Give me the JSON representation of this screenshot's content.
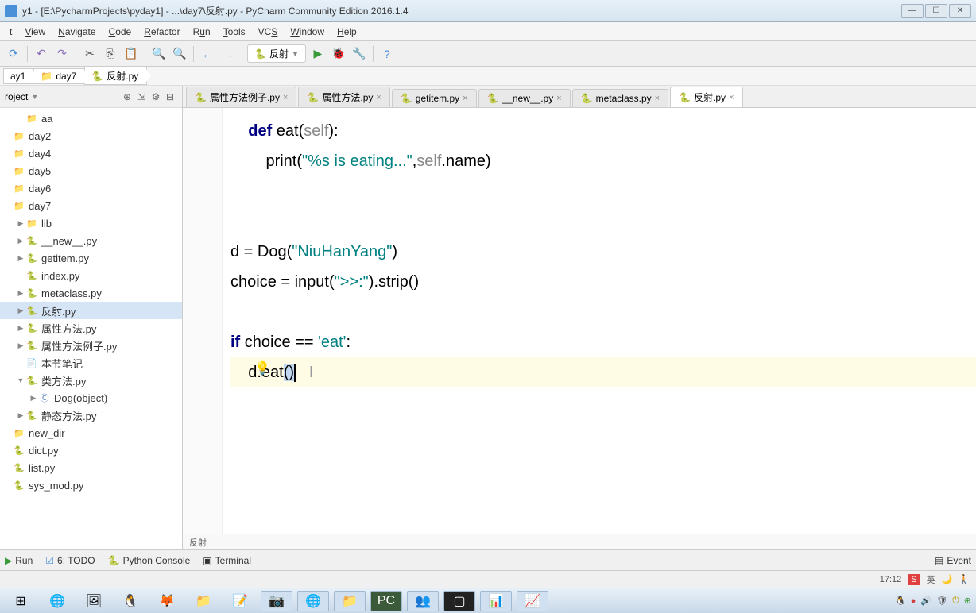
{
  "window": {
    "title": "y1 - [E:\\PycharmProjects\\pyday1] - ...\\day7\\反射.py - PyCharm Community Edition 2016.1.4"
  },
  "menu": {
    "items": [
      "t",
      "View",
      "Navigate",
      "Code",
      "Refactor",
      "Run",
      "Tools",
      "VCS",
      "Window",
      "Help"
    ]
  },
  "toolbar": {
    "run_config": "反射"
  },
  "breadcrumb": {
    "items": [
      "ay1",
      "day7",
      "反射.py"
    ]
  },
  "project": {
    "header": "roject",
    "tree": [
      {
        "label": "aa",
        "indent": 1,
        "icon": "folder",
        "arrow": ""
      },
      {
        "label": "day2",
        "indent": 0,
        "icon": "folder",
        "arrow": ""
      },
      {
        "label": "day4",
        "indent": 0,
        "icon": "folder",
        "arrow": ""
      },
      {
        "label": "day5",
        "indent": 0,
        "icon": "folder",
        "arrow": ""
      },
      {
        "label": "day6",
        "indent": 0,
        "icon": "folder",
        "arrow": ""
      },
      {
        "label": "day7",
        "indent": 0,
        "icon": "folder",
        "arrow": ""
      },
      {
        "label": "lib",
        "indent": 1,
        "icon": "folder",
        "arrow": "▶"
      },
      {
        "label": "__new__.py",
        "indent": 1,
        "icon": "py",
        "arrow": "▶"
      },
      {
        "label": "getitem.py",
        "indent": 1,
        "icon": "py",
        "arrow": "▶"
      },
      {
        "label": "index.py",
        "indent": 1,
        "icon": "py",
        "arrow": ""
      },
      {
        "label": "metaclass.py",
        "indent": 1,
        "icon": "py",
        "arrow": "▶"
      },
      {
        "label": "反射.py",
        "indent": 1,
        "icon": "py",
        "arrow": "▶",
        "selected": true
      },
      {
        "label": "属性方法.py",
        "indent": 1,
        "icon": "py",
        "arrow": "▶"
      },
      {
        "label": "属性方法例子.py",
        "indent": 1,
        "icon": "py",
        "arrow": "▶"
      },
      {
        "label": "本节笔记",
        "indent": 1,
        "icon": "file",
        "arrow": ""
      },
      {
        "label": "类方法.py",
        "indent": 1,
        "icon": "py",
        "arrow": "▼"
      },
      {
        "label": "Dog(object)",
        "indent": 2,
        "icon": "class",
        "arrow": "▶"
      },
      {
        "label": "静态方法.py",
        "indent": 1,
        "icon": "py",
        "arrow": "▶"
      },
      {
        "label": "new_dir",
        "indent": 0,
        "icon": "folder",
        "arrow": ""
      },
      {
        "label": "dict.py",
        "indent": 0,
        "icon": "py",
        "arrow": ""
      },
      {
        "label": "list.py",
        "indent": 0,
        "icon": "py",
        "arrow": ""
      },
      {
        "label": "sys_mod.py",
        "indent": 0,
        "icon": "py",
        "arrow": ""
      }
    ]
  },
  "tabs": {
    "items": [
      {
        "label": "属性方法例子.py",
        "active": false
      },
      {
        "label": "属性方法.py",
        "active": false
      },
      {
        "label": "getitem.py",
        "active": false
      },
      {
        "label": "__new__.py",
        "active": false
      },
      {
        "label": "metaclass.py",
        "active": false
      },
      {
        "label": "反射.py",
        "active": true
      }
    ]
  },
  "code": {
    "line1_kw": "def",
    "line1_fn": " eat",
    "line1_paren_open": "(",
    "line1_param": "self",
    "line1_paren_close": "):",
    "line2_print": "print",
    "line2_open": "(",
    "line2_str": "\"%s is eating...\"",
    "line2_comma": ",",
    "line2_self": "self",
    "line2_name": ".name)",
    "line3_d": "d = Dog(",
    "line3_str": "\"NiuHanYang\"",
    "line3_close": ")",
    "line4_choice": "choice = ",
    "line4_input": "input",
    "line4_open": "(",
    "line4_str": "\">>:\"",
    "line4_rest": ").strip()",
    "line5_if": "if",
    "line5_cond": " choice == ",
    "line5_str": "'eat'",
    "line5_colon": ":",
    "line6_call": "d.eat",
    "line6_paren": "()"
  },
  "editor_crumb": "反射",
  "bottom_tools": {
    "run": "Run",
    "todo": "6: TODO",
    "console": "Python Console",
    "terminal": "Terminal",
    "event": "Event"
  },
  "status": {
    "time": "17:12",
    "lang": "英"
  }
}
